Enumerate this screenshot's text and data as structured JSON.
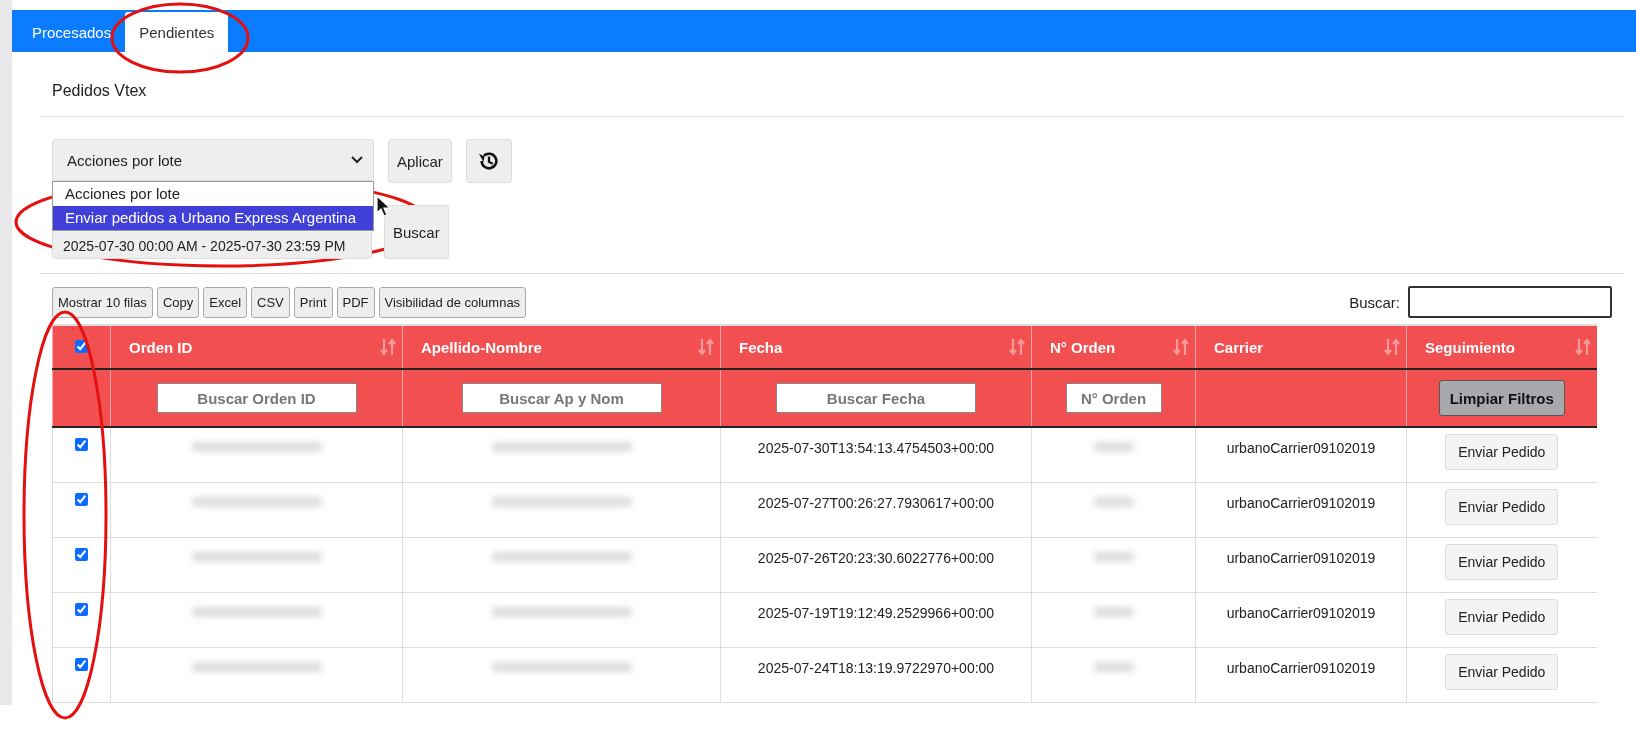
{
  "tabs": [
    {
      "label": "Procesados",
      "selected": false
    },
    {
      "label": "Pendientes",
      "selected": true
    }
  ],
  "section_title": "Pedidos Vtex",
  "batch_select": {
    "value": "Acciones por lote",
    "options": [
      {
        "label": "Acciones por lote",
        "highlighted": false
      },
      {
        "label": "Enviar pedidos a Urbano Express Argentina",
        "highlighted": true
      }
    ],
    "expanded": true
  },
  "apply_button": "Aplicar",
  "date_range": "2025-07-30 00:00 AM - 2025-07-30 23:59 PM",
  "search_button": "Buscar",
  "export_buttons": [
    "Mostrar 10 filas",
    "Copy",
    "Excel",
    "CSV",
    "Print",
    "PDF",
    "Visibilidad de columnas"
  ],
  "global_search": {
    "label": "Buscar:"
  },
  "table": {
    "select_all": {
      "checked": true
    },
    "columns": [
      "Orden ID",
      "Apellido-Nombre",
      "Fecha",
      "N° Orden",
      "Carrier",
      "Seguimiento"
    ],
    "filters": [
      {
        "kind": "input",
        "placeholder": "Buscar Orden ID"
      },
      {
        "kind": "input",
        "placeholder": "Buscar Ap y Nom"
      },
      {
        "kind": "input",
        "placeholder": "Buscar Fecha"
      },
      {
        "kind": "input",
        "placeholder": "N° Orden"
      },
      {
        "kind": "empty"
      },
      {
        "kind": "button",
        "label": "Limpiar Filtros"
      }
    ],
    "rows": [
      {
        "checked": true,
        "fecha": "2025-07-30T13:54:13.4754503+00:00",
        "carrier": "urbanoCarrier09102019",
        "action": "Enviar Pedido"
      },
      {
        "checked": true,
        "fecha": "2025-07-27T00:26:27.7930617+00:00",
        "carrier": "urbanoCarrier09102019",
        "action": "Enviar Pedido"
      },
      {
        "checked": true,
        "fecha": "2025-07-26T20:23:30.6022776+00:00",
        "carrier": "urbanoCarrier09102019",
        "action": "Enviar Pedido"
      },
      {
        "checked": true,
        "fecha": "2025-07-19T19:12:49.2529966+00:00",
        "carrier": "urbanoCarrier09102019",
        "action": "Enviar Pedido"
      },
      {
        "checked": true,
        "fecha": "2025-07-24T18:13:19.9722970+00:00",
        "carrier": "urbanoCarrier09102019",
        "action": "Enviar Pedido"
      }
    ]
  },
  "annotations": [
    {
      "kind": "ellipse"
    },
    {
      "kind": "ellipse"
    },
    {
      "kind": "ellipse"
    }
  ]
}
